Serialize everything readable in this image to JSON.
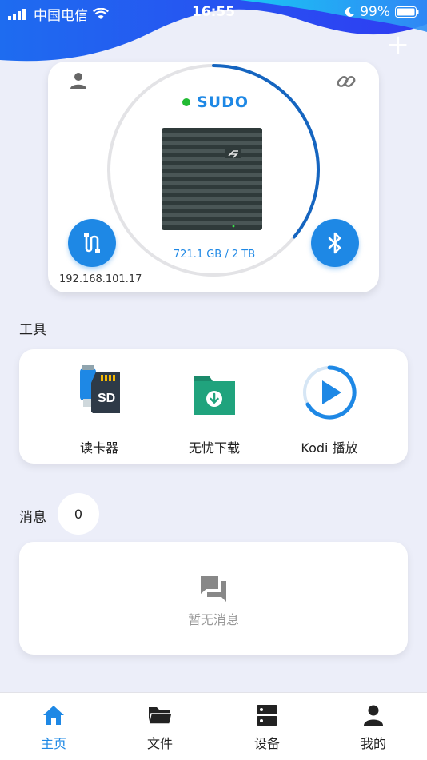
{
  "status_bar": {
    "carrier": "中国电信",
    "time": "16:55",
    "battery": "99%"
  },
  "device": {
    "name": "SUDO",
    "online_color": "#22bb33",
    "storage_used": "721.1 GB / 2 TB",
    "storage_fraction": 0.36,
    "ip": "192.168.101.17",
    "icons": [
      "user-icon",
      "link-icon",
      "network-icon",
      "bluetooth-icon"
    ]
  },
  "tools": {
    "title": "工具",
    "items": [
      {
        "label": "读卡器",
        "icon": "card-reader-icon"
      },
      {
        "label": "无忧下载",
        "icon": "download-folder-icon"
      },
      {
        "label": "Kodi 播放",
        "icon": "play-icon"
      }
    ]
  },
  "messages": {
    "title": "消息",
    "count": "0",
    "empty_text": "暂无消息"
  },
  "tabs": [
    {
      "label": "主页",
      "icon": "home-icon",
      "active": true
    },
    {
      "label": "文件",
      "icon": "folder-icon",
      "active": false
    },
    {
      "label": "设备",
      "icon": "server-icon",
      "active": false
    },
    {
      "label": "我的",
      "icon": "person-icon",
      "active": false
    }
  ],
  "colors": {
    "accent": "#1e88e5",
    "background": "#eceef9"
  }
}
